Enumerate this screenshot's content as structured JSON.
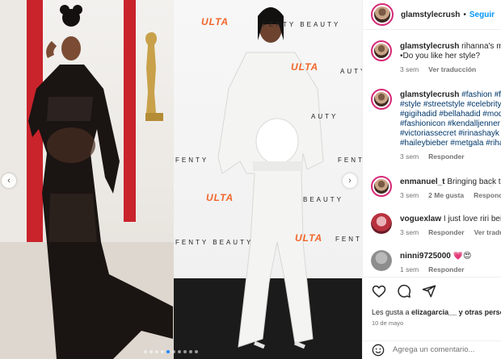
{
  "media": {
    "left_photo": {
      "sponsor_texts": []
    },
    "right_photo": {
      "ulta_text": "ULTA",
      "sponsor_text": "FENTY BEAUTY",
      "sponsor_fragments": [
        "FENTY BEAUTY",
        "BEAUTY",
        "AUTY",
        "FENTY",
        "BEAUTY",
        "FENTY BEAUTY",
        "FENTY"
      ]
    },
    "carousel_dots": 10,
    "active_dot": 4,
    "arrow_left_icon": "chevron-left-icon",
    "arrow_right_icon": "chevron-right-icon"
  },
  "post": {
    "username": "glamstylecrush",
    "separator": "•",
    "follow_label": "Seguir",
    "caption_user": "glamstylecrush",
    "caption_text": " rihanna's maternity style",
    "caption_line2": "•Do you like her style?",
    "caption_meta_time": "3 sem",
    "caption_meta_translate": "Ver traducción",
    "hashtag_comment": {
      "user": "glamstylecrush",
      "lines": [
        "#fashion #fashionista",
        "#style #streetstyle #celebrity",
        "#gigihadid #bellahadid #model",
        "#fashionicon #kendalljenner #",
        "#victoriassecret #irinashayk #",
        "#haileybieber #metgala #rihanna"
      ],
      "time": "3 sem",
      "reply": "Responder"
    }
  },
  "comments": [
    {
      "user": "enmanuel_t",
      "text": " Bringing back the style",
      "time": "3 sem",
      "likes": "2 Me gusta",
      "reply": "Responder",
      "avatar": "photo"
    },
    {
      "user": "voguexlaw",
      "text": " I just love riri being",
      "time": "3 sem",
      "likes": "",
      "reply": "Responder",
      "translate": "Ver traducción",
      "avatar": "red"
    },
    {
      "user": "ninni9725000",
      "text": " 💗😍",
      "time": "1 sem",
      "likes": "",
      "reply": "Responder",
      "avatar": "gray"
    }
  ],
  "actions": {
    "icons": [
      "heart-icon",
      "comment-icon",
      "share-icon"
    ],
    "likes_prefix": "Les gusta a ",
    "likes_user": "elizagarcia__",
    "likes_suffix": " y otras personas",
    "date": "10 de mayo",
    "comment_placeholder": "Agrega un comentario...",
    "emoji_icon": "emoji-icon"
  },
  "colors": {
    "link_blue": "#0095f6",
    "hashtag_blue": "#00376b",
    "story_ring": "#d62976",
    "meta_gray": "#737373"
  }
}
